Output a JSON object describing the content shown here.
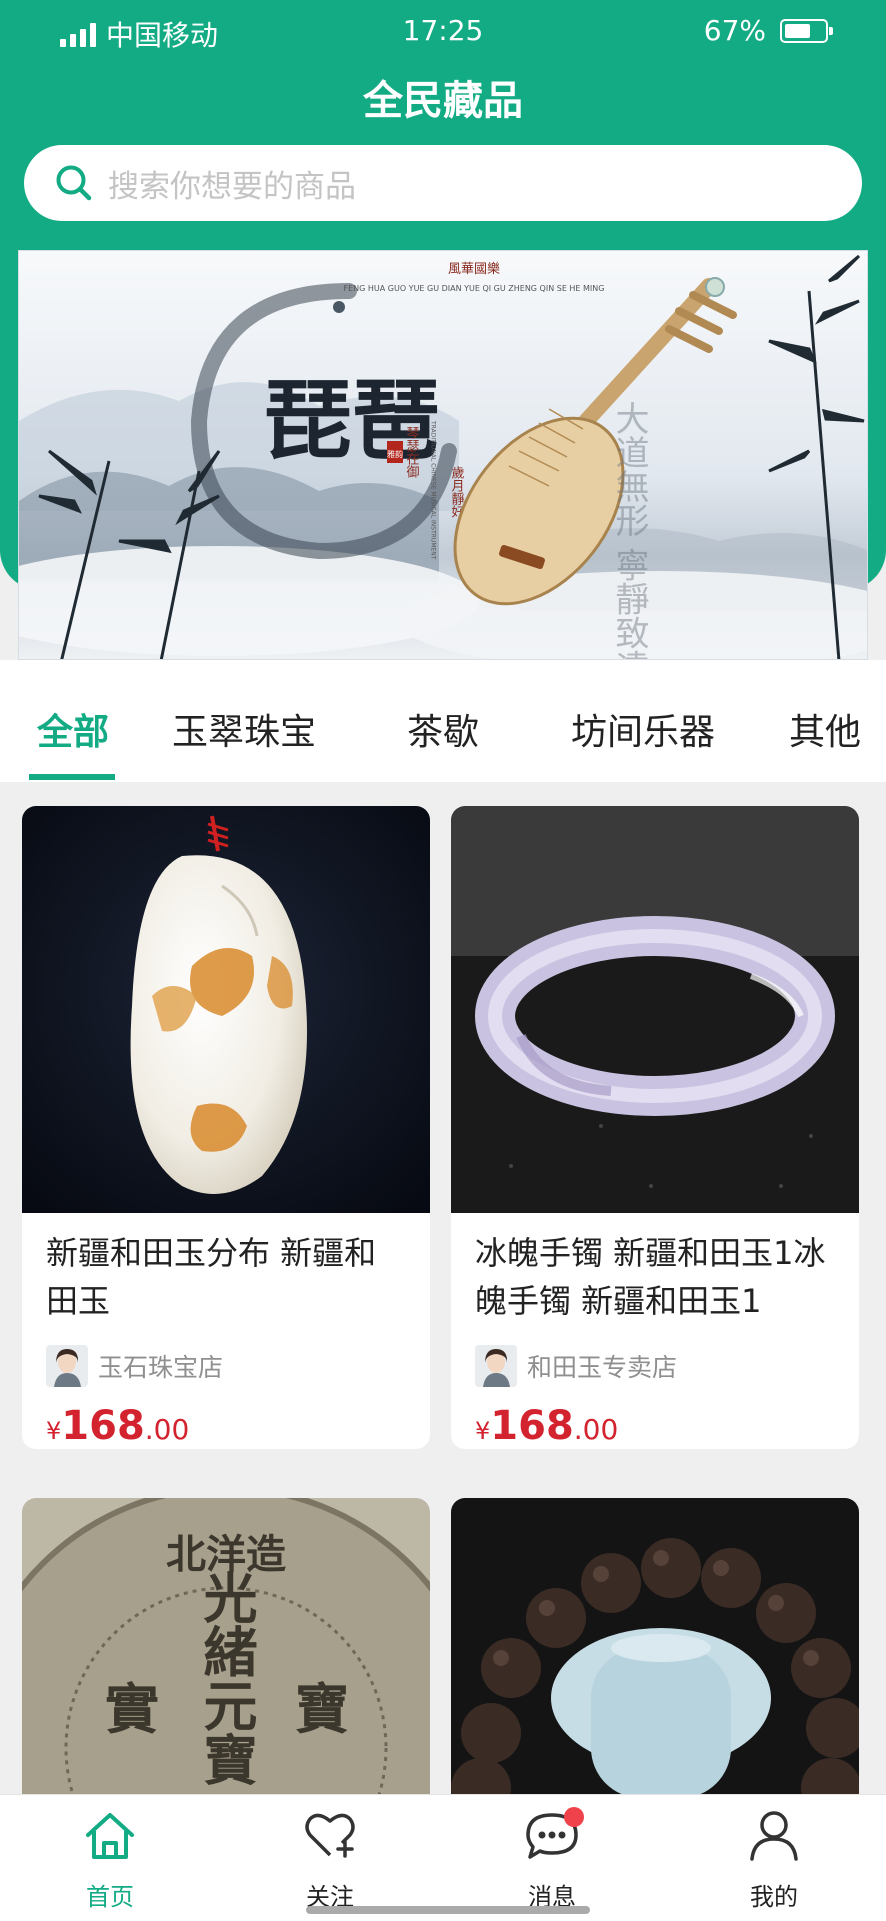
{
  "status_bar": {
    "carrier": "中国移动",
    "time": "17:25",
    "battery": "67%",
    "battery_level": 0.67
  },
  "header": {
    "title": "全民藏品"
  },
  "search": {
    "placeholder": "搜索你想要的商品"
  },
  "banner": {
    "top_text": "風華國樂",
    "romanization": "FENG HUA GUO YUE GU DIAN YUE QI GU ZHENG QIN SE HE MING",
    "title": "琵琶",
    "seal": "雅韵",
    "side_line1": "琴瑟在御",
    "side_line2": "歲月靜好",
    "side_english": "TRADITIONAL CHINESE MUSICAL INSTRUMENT",
    "calligraphy": "大道無形 寧靜致遠"
  },
  "tabs": [
    "全部",
    "玉翠珠宝",
    "茶歇",
    "坊间乐器",
    "其他"
  ],
  "active_tab": 0,
  "products": [
    {
      "title": "新疆和田玉分布 新疆和田玉",
      "shop": "玉石珠宝店",
      "currency": "¥",
      "price_int": "168",
      "price_dec": ".00"
    },
    {
      "title": "冰魄手镯 新疆和田玉1冰魄手镯 新疆和田玉1",
      "shop": "和田玉专卖店",
      "currency": "¥",
      "price_int": "168",
      "price_dec": ".00"
    }
  ],
  "coin": {
    "top": "北洋造",
    "center": "光緒元寶",
    "left": "實",
    "right": "寶"
  },
  "tabbar": [
    {
      "label": "首页",
      "icon": "home-icon",
      "active": true
    },
    {
      "label": "关注",
      "icon": "heart-plus-icon",
      "active": false
    },
    {
      "label": "消息",
      "icon": "chat-icon",
      "active": false,
      "badge": true
    },
    {
      "label": "我的",
      "icon": "user-icon",
      "active": false
    }
  ],
  "colors": {
    "accent": "#13ab84",
    "price": "#d3232f",
    "badge": "#f0424b"
  }
}
